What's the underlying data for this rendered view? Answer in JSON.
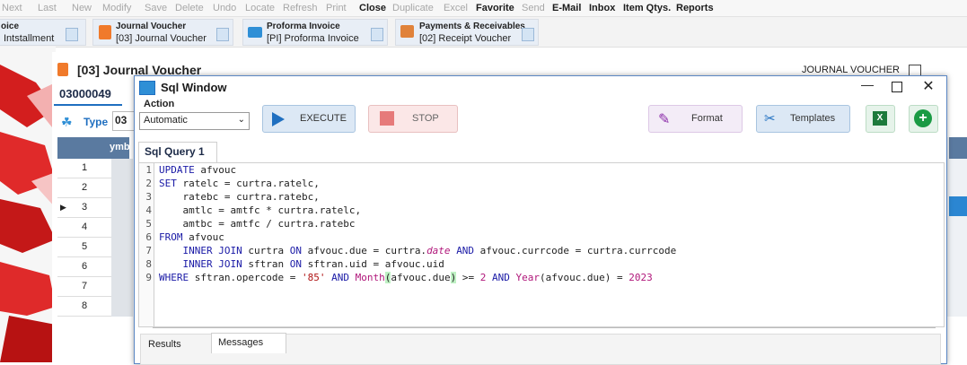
{
  "toolbar": {
    "items": [
      {
        "label": "Next",
        "enabled": false
      },
      {
        "label": "Last",
        "enabled": false
      },
      {
        "label": "New",
        "enabled": false
      },
      {
        "label": "Modify",
        "enabled": false
      },
      {
        "label": "Save",
        "enabled": false
      },
      {
        "label": "Delete",
        "enabled": false
      },
      {
        "label": "Undo",
        "enabled": false
      },
      {
        "label": "Locate",
        "enabled": false
      },
      {
        "label": "Refresh",
        "enabled": false
      },
      {
        "label": "Print",
        "enabled": false
      },
      {
        "label": "Close",
        "enabled": true
      },
      {
        "label": "Duplicate",
        "enabled": false
      },
      {
        "label": "Excel",
        "enabled": false
      },
      {
        "label": "Favorite",
        "enabled": true
      },
      {
        "label": "Send",
        "enabled": false
      },
      {
        "label": "E-Mail",
        "enabled": true
      },
      {
        "label": "Inbox",
        "enabled": true
      },
      {
        "label": "Item Qtys.",
        "enabled": true
      },
      {
        "label": "Reports",
        "enabled": true
      }
    ]
  },
  "doc_tabs": [
    {
      "title": "oice",
      "subtitle": "Intstallment",
      "icon": "installment-icon",
      "color": "#e0a24b"
    },
    {
      "title": "Journal Voucher",
      "subtitle": "[03] Journal Voucher",
      "icon": "journal-voucher-icon",
      "color": "#f07a2b"
    },
    {
      "title": "Proforma Invoice",
      "subtitle": "[PI] Proforma Invoice",
      "icon": "proforma-invoice-icon",
      "color": "#2f8fd6"
    },
    {
      "title": "Payments & Receivables",
      "subtitle": "[02] Receipt Voucher",
      "icon": "payments-icon",
      "color": "#e0823a"
    }
  ],
  "journal_window": {
    "title": "[03] Journal Voucher",
    "type_label": "JOURNAL VOUCHER",
    "voucher_no": "03000049",
    "type_field_label": "Type",
    "type_value": "03",
    "grid_header": "ymb",
    "rows": [
      "1",
      "2",
      "3",
      "4",
      "5",
      "6",
      "7",
      "8"
    ],
    "current_row": "3"
  },
  "sql_window": {
    "title": "Sql Window",
    "action_label": "Action",
    "action_value": "Automatic",
    "execute_label": "EXECUTE",
    "stop_label": "STOP",
    "format_label": "Format",
    "templates_label": "Templates",
    "query_tab": "Sql Query 1",
    "result_tabs": [
      "Results",
      "Messages"
    ],
    "active_result_tab": "Messages",
    "sql_lines": [
      "UPDATE afvouc",
      "SET ratelc = curtra.ratelc,",
      "    ratebc = curtra.ratebc,",
      "    amtlc = amtfc * curtra.ratelc,",
      "    amtbc = amtfc / curtra.ratebc",
      "FROM afvouc",
      "    INNER JOIN curtra ON afvouc.due = curtra.date AND afvouc.currcode = curtra.currcode",
      "    INNER JOIN sftran ON sftran.uid = afvouc.uid",
      "WHERE sftran.opercode = '85' AND Month(afvouc.due) >= 2 AND Year(afvouc.due) = 2023"
    ]
  },
  "colors": {
    "accent": "#1f6fc0",
    "window_border": "#5b87c4",
    "add_button": "#1a9a44",
    "excel_button": "#1d7a3c"
  }
}
